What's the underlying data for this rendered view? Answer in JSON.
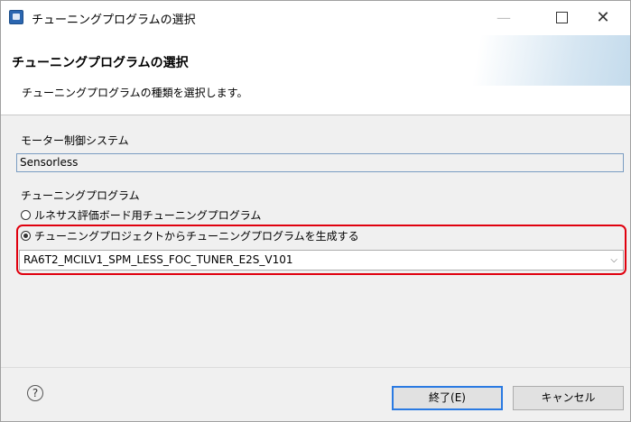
{
  "window": {
    "title": "チューニングプログラムの選択",
    "minimize": "—",
    "close": "✕"
  },
  "banner": {
    "title": "チューニングプログラムの選択",
    "description": "チューニングプログラムの種類を選択します。"
  },
  "motor_system": {
    "label": "モーター制御システム",
    "value": "Sensorless"
  },
  "tuning_program": {
    "label": "チューニングプログラム",
    "options": [
      {
        "label": "ルネサス評価ボード用チューニングプログラム",
        "selected": false
      },
      {
        "label": "チューニングプロジェクトからチューニングプログラムを生成する",
        "selected": true
      }
    ],
    "project_select": "RA6T2_MCILV1_SPM_LESS_FOC_TUNER_E2S_V101"
  },
  "footer": {
    "help": "?",
    "finish_label": "終了(E)",
    "cancel_label": "キャンセル"
  },
  "colors": {
    "highlight": "#e0000e",
    "default_button_border": "#2a7ae2"
  }
}
